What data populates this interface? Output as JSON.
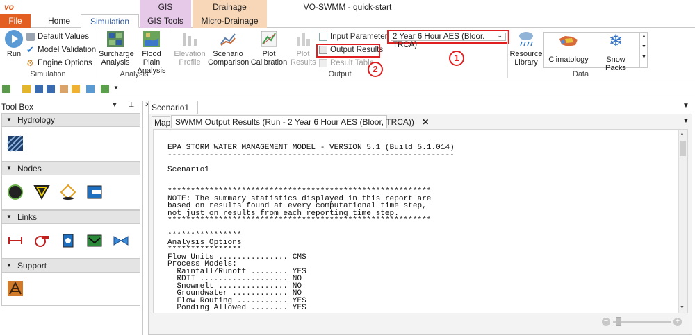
{
  "window": {
    "title": "VO-SWMM - quick-start",
    "logo": "vo"
  },
  "context_tabs": {
    "gis": "GIS",
    "drainage": "Drainage"
  },
  "tabs": {
    "file": "File",
    "home": "Home",
    "simulation": "Simulation",
    "gis_tools": "GIS Tools",
    "micro_drainage": "Micro-Drainage"
  },
  "ribbon": {
    "simulation_group": {
      "label": "Simulation",
      "run": "Run",
      "default_values": "Default Values",
      "model_validation": "Model Validation",
      "engine_options": "Engine Options"
    },
    "analysis_group": {
      "label": "Analysis",
      "surcharge_line1": "Surcharge",
      "surcharge_line2": "Analysis",
      "flood_line1": "Flood Plain",
      "flood_line2": "Analysis"
    },
    "output_group": {
      "label": "Output",
      "elev_line1": "Elevation",
      "elev_line2": "Profile",
      "scen_line1": "Scenario",
      "scen_line2": "Comparison",
      "plot_line1": "Plot",
      "plot_line2": "Calibration",
      "plotres_line1": "Plot",
      "plotres_line2": "Results",
      "input_parameters": "Input Parameters",
      "output_results": "Output Results",
      "result_table": "Result Table",
      "run_selector": "2 Year 6 Hour AES (Bloor. TRCA)"
    },
    "data_group": {
      "label": "Data",
      "resource_line1": "Resource",
      "resource_line2": "Library",
      "climatology": "Climatology",
      "snow_packs": "Snow Packs"
    }
  },
  "annotations": {
    "one": "1",
    "two": "2"
  },
  "toolbox": {
    "title": "Tool Box",
    "sections": [
      {
        "label": "Hydrology"
      },
      {
        "label": "Nodes"
      },
      {
        "label": "Links"
      },
      {
        "label": "Support"
      }
    ]
  },
  "documents": {
    "outer_tab": "Scenario1",
    "map_tab": "Map",
    "results_tab": "SWMM Output Results (Run - 2 Year 6 Hour AES (Bloor, TRCA))"
  },
  "report": {
    "lines": [
      "EPA STORM WATER MANAGEMENT MODEL - VERSION 5.1 (Build 5.1.014)",
      "--------------------------------------------------------------",
      "",
      "Scenario1",
      "",
      "",
      "*********************************************************",
      "NOTE: The summary statistics displayed in this report are",
      "based on results found at every computational time step,",
      "not just on results from each reporting time step.",
      "*********************************************************",
      "",
      "****************",
      "Analysis Options",
      "****************",
      "Flow Units ............... CMS",
      "Process Models:",
      "  Rainfall/Runoff ........ YES",
      "  RDII ................... NO",
      "  Snowmelt ............... NO",
      "  Groundwater ............ NO",
      "  Flow Routing ........... YES",
      "  Ponding Allowed ........ YES"
    ]
  },
  "colors": {
    "accent": "#2b579a",
    "file_tab": "#e35f21",
    "highlight": "#e02020",
    "gis": "#e6c8e8",
    "drainage": "#f7d7b8"
  }
}
